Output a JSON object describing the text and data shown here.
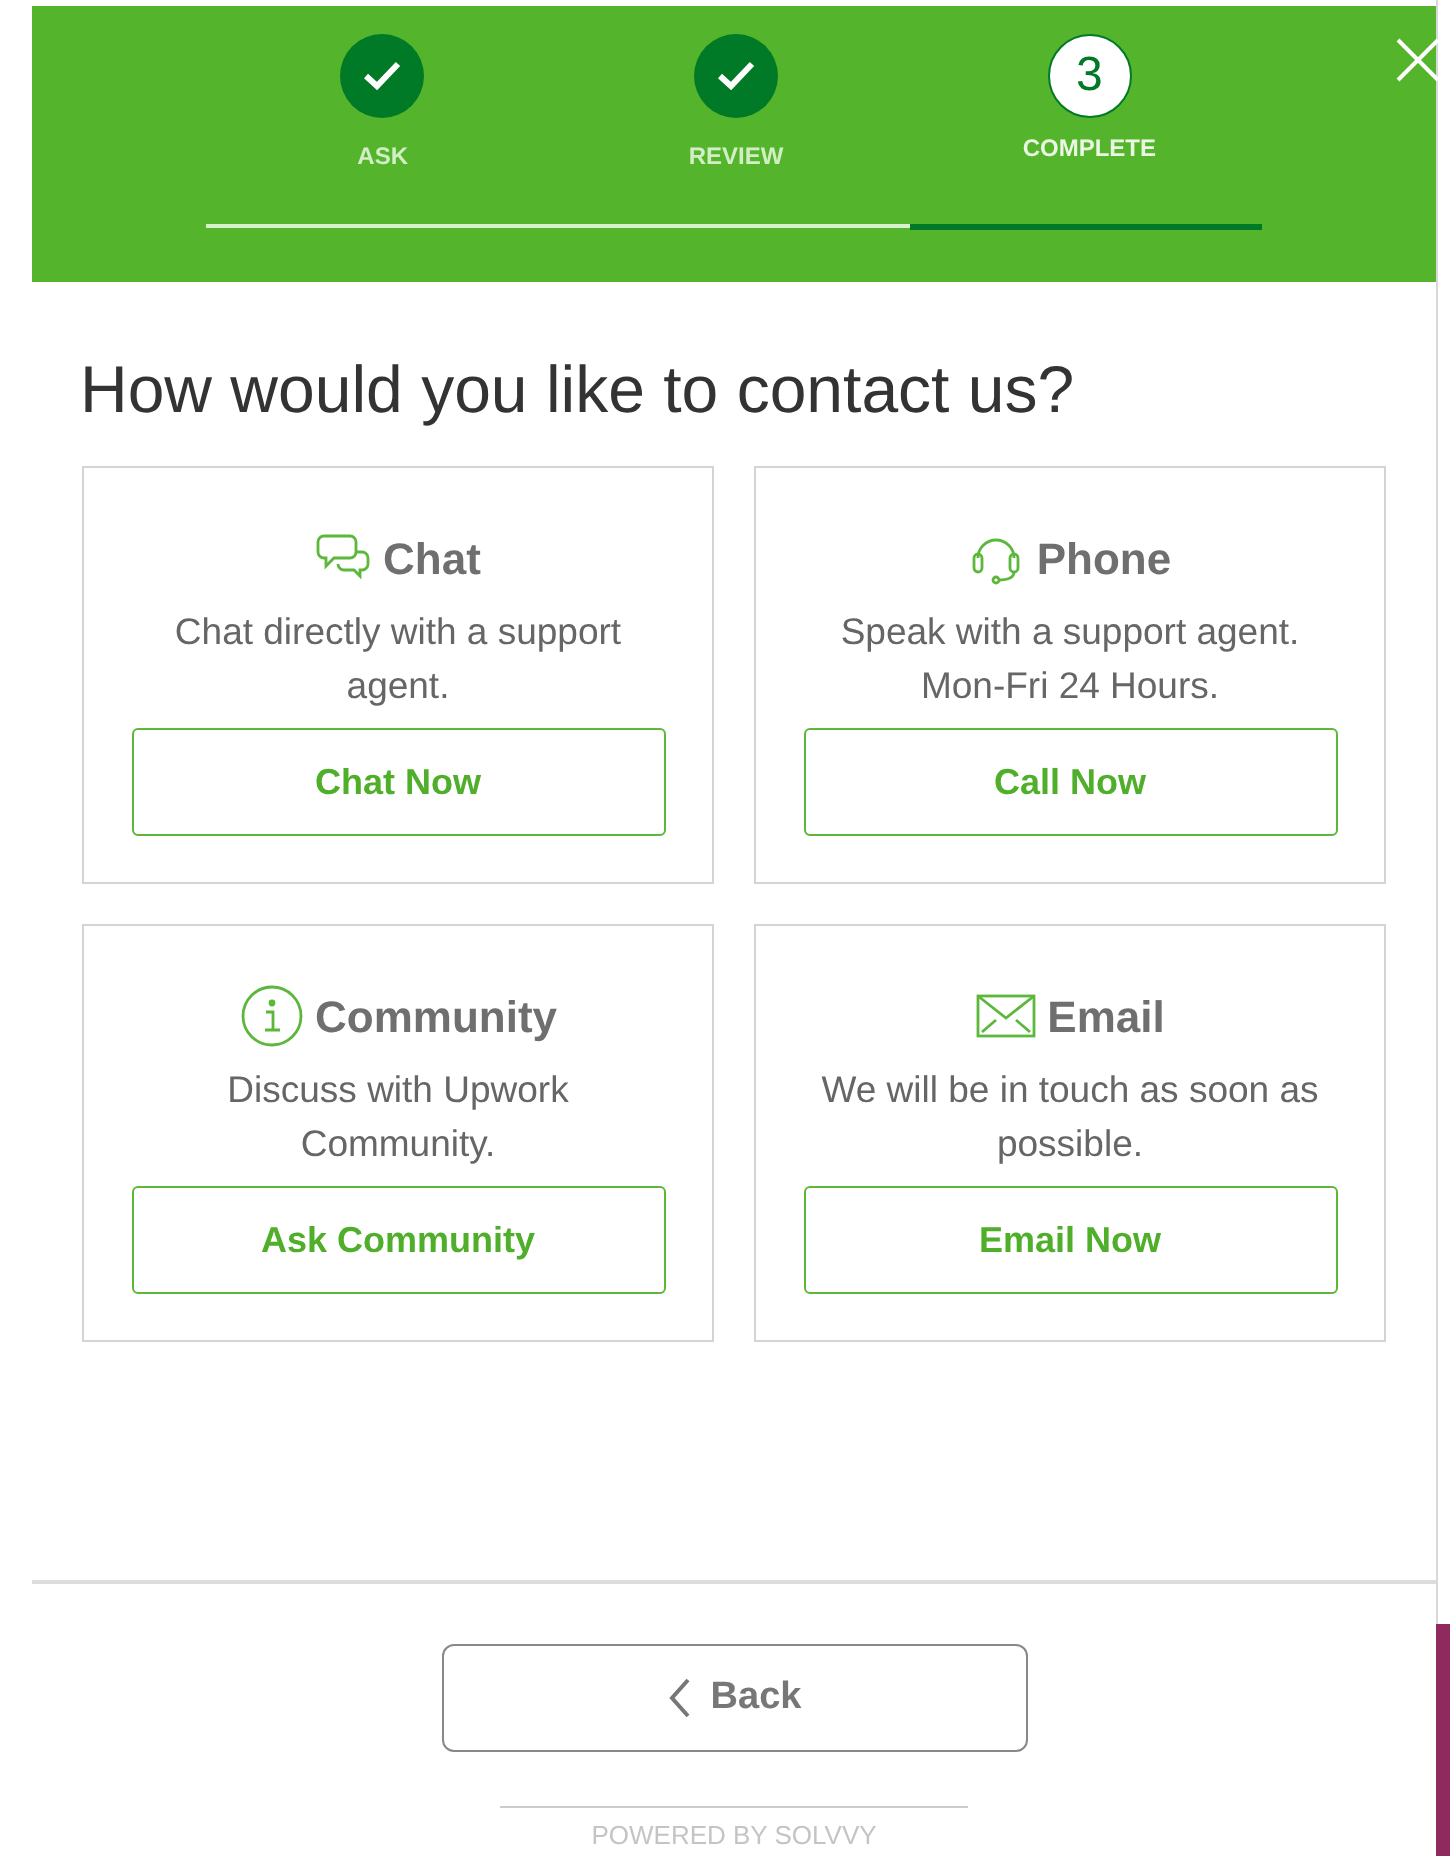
{
  "steps": [
    {
      "label": "ASK",
      "completed": true,
      "selected": false
    },
    {
      "label": "REVIEW",
      "completed": true,
      "selected": false
    },
    {
      "label": "COMPLETE",
      "number": "3",
      "completed": false,
      "selected": true
    }
  ],
  "heading": "How would you like to contact us?",
  "options": [
    {
      "kind": "chat",
      "title": "Chat",
      "description": "Chat directly with a support agent.",
      "button": "Chat Now"
    },
    {
      "kind": "phone",
      "title": "Phone",
      "description": "Speak with a support agent. Mon-Fri 24 Hours.",
      "button": "Call Now"
    },
    {
      "kind": "community",
      "title": "Community",
      "description": "Discuss with Upwork Community.",
      "button": "Ask Community"
    },
    {
      "kind": "email",
      "title": "Email",
      "description": "We will be in touch as soon as possible.",
      "button": "Email Now"
    }
  ],
  "back_button": "Back",
  "footer": "POWERED BY SOLVVY"
}
